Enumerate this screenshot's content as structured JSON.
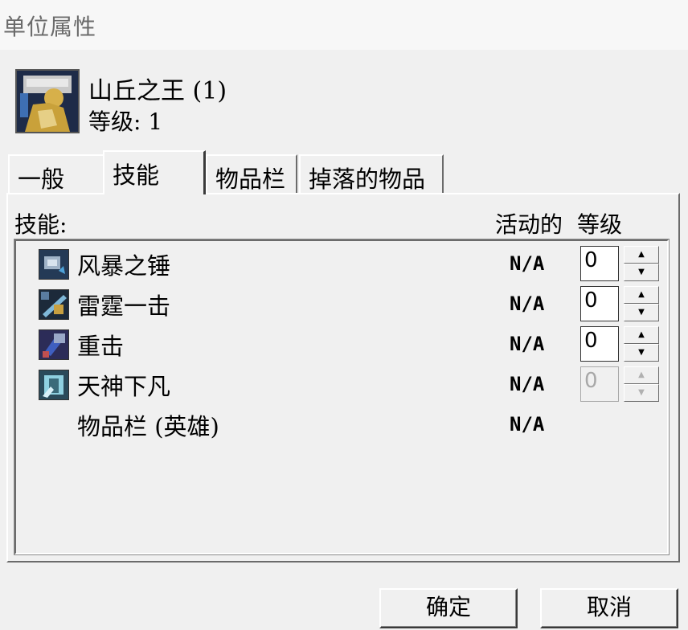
{
  "window": {
    "title": "单位属性"
  },
  "unit": {
    "name": "山丘之王 (1)",
    "level_text": "等级: 1"
  },
  "tabs": [
    {
      "label": "一般",
      "active": false
    },
    {
      "label": "技能",
      "active": true
    },
    {
      "label": "物品栏",
      "active": false
    },
    {
      "label": "掉落的物品",
      "active": false
    }
  ],
  "skills_panel": {
    "list_label": "技能:",
    "col_active": "活动的",
    "col_level": "等级",
    "rows": [
      {
        "name": "风暴之锤",
        "active": "N/A",
        "level": "0",
        "icon": "storm-bolt-icon",
        "spinner_enabled": true
      },
      {
        "name": "雷霆一击",
        "active": "N/A",
        "level": "0",
        "icon": "thunder-clap-icon",
        "spinner_enabled": true
      },
      {
        "name": "重击",
        "active": "N/A",
        "level": "0",
        "icon": "bash-icon",
        "spinner_enabled": true
      },
      {
        "name": "天神下凡",
        "active": "N/A",
        "level": "0",
        "icon": "avatar-icon",
        "spinner_enabled": false
      },
      {
        "name": "物品栏 (英雄)",
        "active": "N/A"
      }
    ]
  },
  "buttons": {
    "ok": "确定",
    "cancel": "取消"
  },
  "colors": {
    "background": "#f0f0f0",
    "title_text": "#6b6b6b",
    "disabled_text": "#a8a8a8"
  }
}
